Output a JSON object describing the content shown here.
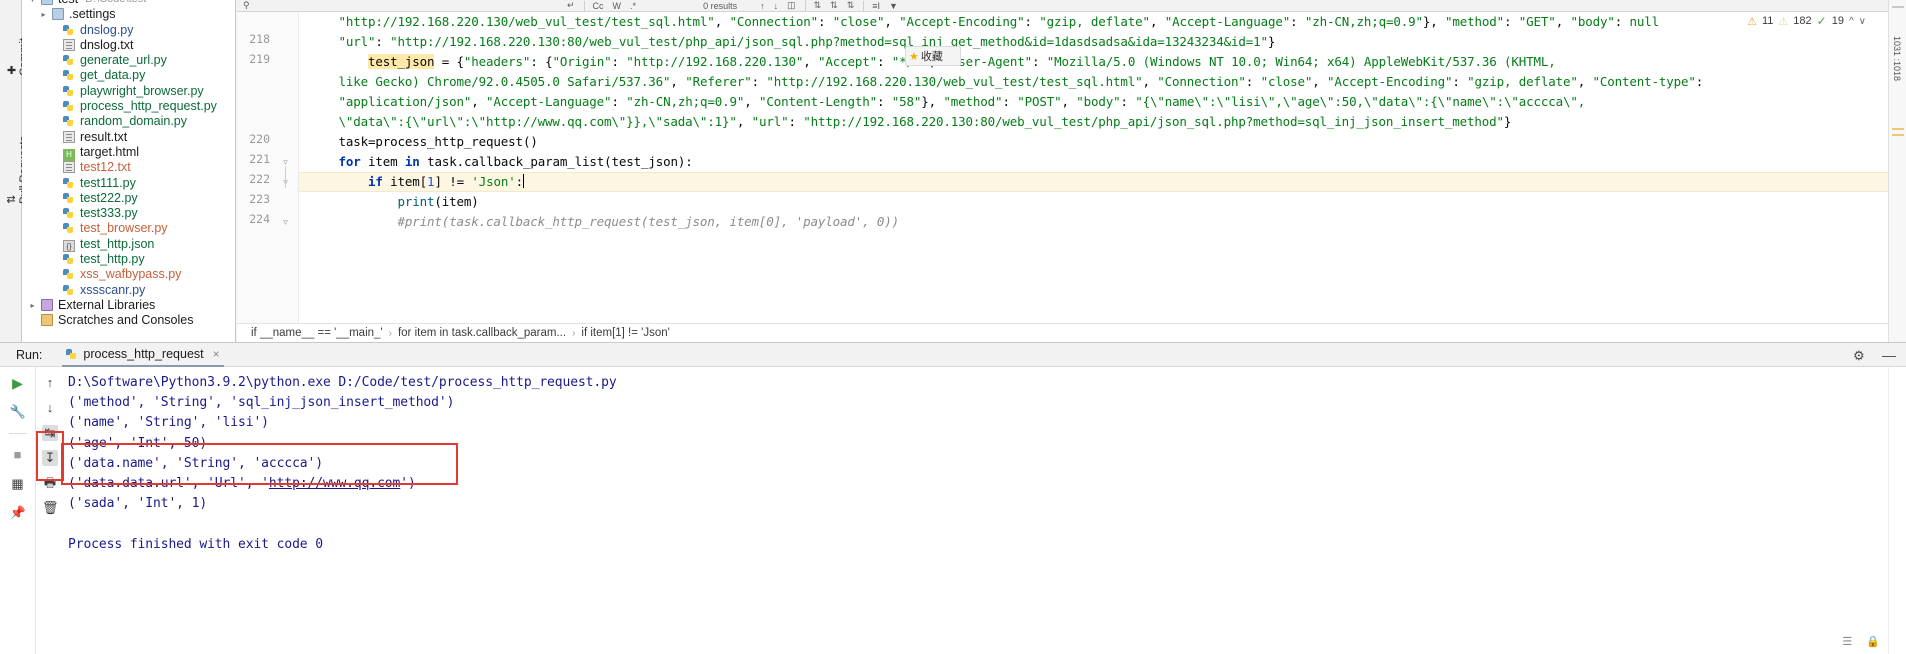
{
  "left_toolwindow": {
    "items": [
      {
        "label": "Commit",
        "icon": "commit-icon"
      },
      {
        "label": "Pull Requests",
        "icon": "pull-request-icon"
      }
    ]
  },
  "project_tree": {
    "items": [
      {
        "name": "test",
        "type": "folder",
        "detail": "D:\\Code\\test",
        "indent": 0,
        "arrow": "expanded",
        "color": "dark"
      },
      {
        "name": ".settings",
        "type": "folder",
        "indent": 1,
        "arrow": "collapsed",
        "color": "dark"
      },
      {
        "name": "dnslog.py",
        "type": "py",
        "indent": 2,
        "arrow": "",
        "color": "blue"
      },
      {
        "name": "dnslog.txt",
        "type": "txt",
        "indent": 2,
        "arrow": "",
        "color": "dark"
      },
      {
        "name": "generate_url.py",
        "type": "py",
        "indent": 2,
        "arrow": "",
        "color": "green"
      },
      {
        "name": "get_data.py",
        "type": "py",
        "indent": 2,
        "arrow": "",
        "color": "green"
      },
      {
        "name": "playwright_browser.py",
        "type": "py",
        "indent": 2,
        "arrow": "",
        "color": "green"
      },
      {
        "name": "process_http_request.py",
        "type": "py",
        "indent": 2,
        "arrow": "",
        "color": "green"
      },
      {
        "name": "random_domain.py",
        "type": "py",
        "indent": 2,
        "arrow": "",
        "color": "green"
      },
      {
        "name": "result.txt",
        "type": "txt",
        "indent": 2,
        "arrow": "",
        "color": "dark"
      },
      {
        "name": "target.html",
        "type": "html",
        "indent": 2,
        "arrow": "",
        "color": "dark"
      },
      {
        "name": "test12.txt",
        "type": "txt",
        "indent": 2,
        "arrow": "",
        "color": "red"
      },
      {
        "name": "test111.py",
        "type": "py",
        "indent": 2,
        "arrow": "",
        "color": "green"
      },
      {
        "name": "test222.py",
        "type": "py",
        "indent": 2,
        "arrow": "",
        "color": "green"
      },
      {
        "name": "test333.py",
        "type": "py",
        "indent": 2,
        "arrow": "",
        "color": "green"
      },
      {
        "name": "test_browser.py",
        "type": "py",
        "indent": 2,
        "arrow": "",
        "color": "red"
      },
      {
        "name": "test_http.json",
        "type": "json",
        "indent": 2,
        "arrow": "",
        "color": "green"
      },
      {
        "name": "test_http.py",
        "type": "py",
        "indent": 2,
        "arrow": "",
        "color": "green"
      },
      {
        "name": "xss_wafbypass.py",
        "type": "py",
        "indent": 2,
        "arrow": "",
        "color": "red"
      },
      {
        "name": "xssscanr.py",
        "type": "py",
        "indent": 2,
        "arrow": "",
        "color": "blue"
      },
      {
        "name": "External Libraries",
        "type": "lib",
        "indent": 0,
        "arrow": "collapsed",
        "color": "dark"
      },
      {
        "name": "Scratches and Consoles",
        "type": "scratch",
        "indent": 0,
        "arrow": "",
        "color": "dark"
      }
    ]
  },
  "find_bar": {
    "search_placeholder": "",
    "results_label": "0 results",
    "icons": [
      "search-icon",
      "enter-icon",
      "match-case-icon",
      "words-icon",
      "regex-icon",
      "up-icon",
      "down-icon",
      "select-all-icon",
      "in-comments-icon",
      "in-literals-icon",
      "in-identifiers-icon",
      "filter-icon",
      "close-icon"
    ]
  },
  "editor": {
    "lines": [
      {
        "number": "",
        "fold": "",
        "segments": [
          {
            "t": "    ",
            "c": "plain"
          },
          {
            "t": "\"http://192.168.220.130/web_vul_test/test_sql.html\"",
            "c": "str"
          },
          {
            "t": ", ",
            "c": "plain"
          },
          {
            "t": "\"Connection\"",
            "c": "str"
          },
          {
            "t": ": ",
            "c": "plain"
          },
          {
            "t": "\"close\"",
            "c": "str"
          },
          {
            "t": ", ",
            "c": "plain"
          },
          {
            "t": "\"Accept-Encoding\"",
            "c": "str"
          },
          {
            "t": ": ",
            "c": "plain"
          },
          {
            "t": "\"gzip, deflate\"",
            "c": "str"
          },
          {
            "t": ", ",
            "c": "plain"
          },
          {
            "t": "\"Accept-Language\"",
            "c": "str"
          },
          {
            "t": ": ",
            "c": "plain"
          },
          {
            "t": "\"zh-CN,zh;q=0.9\"",
            "c": "str"
          },
          {
            "t": "}, ",
            "c": "plain"
          },
          {
            "t": "\"method\"",
            "c": "str"
          },
          {
            "t": ": ",
            "c": "plain"
          },
          {
            "t": "\"GET\"",
            "c": "str"
          },
          {
            "t": ", ",
            "c": "plain"
          },
          {
            "t": "\"body\"",
            "c": "str"
          },
          {
            "t": ": ",
            "c": "plain"
          },
          {
            "t": "null",
            "c": "str"
          }
        ]
      },
      {
        "number": "218",
        "fold": "",
        "segments": [
          {
            "t": "    ",
            "c": "plain"
          },
          {
            "t": "\"url\"",
            "c": "str"
          },
          {
            "t": ": ",
            "c": "plain"
          },
          {
            "t": "\"http://192.168.220.130:80/web_vul_test/php_api/json_sql.php?method=sql_inj_get_method&id=1dasdsadsa&ida=13243234&id=1\"",
            "c": "str"
          },
          {
            "t": "}",
            "c": "plain"
          }
        ]
      },
      {
        "number": "219",
        "fold": "",
        "segments": [
          {
            "t": "        ",
            "c": "plain"
          },
          {
            "t": "test_json",
            "c": "hl"
          },
          {
            "t": " = {",
            "c": "plain"
          },
          {
            "t": "\"headers\"",
            "c": "str"
          },
          {
            "t": ": {",
            "c": "plain"
          },
          {
            "t": "\"Origin\"",
            "c": "str"
          },
          {
            "t": ": ",
            "c": "plain"
          },
          {
            "t": "\"http://192.168.220.130\"",
            "c": "str"
          },
          {
            "t": ", ",
            "c": "plain"
          },
          {
            "t": "\"Accept\"",
            "c": "str"
          },
          {
            "t": ": ",
            "c": "plain"
          },
          {
            "t": "\"*/*\"",
            "c": "str"
          },
          {
            "t": ", ",
            "c": "plain"
          },
          {
            "t": "\"User-Agent\"",
            "c": "str"
          },
          {
            "t": ": ",
            "c": "plain"
          },
          {
            "t": "\"Mozilla/5.0 (Windows NT 10.0; Win64; x64) AppleWebKit/537.36 (KHTML,",
            "c": "str"
          }
        ]
      },
      {
        "number": "",
        "fold": "",
        "segments": [
          {
            "t": "    ",
            "c": "plain"
          },
          {
            "t": "like Gecko) Chrome/92.0.4505.0 Safari/537.36\"",
            "c": "str"
          },
          {
            "t": ", ",
            "c": "plain"
          },
          {
            "t": "\"Referer\"",
            "c": "str"
          },
          {
            "t": ": ",
            "c": "plain"
          },
          {
            "t": "\"http://192.168.220.130/web_vul_test/test_sql.html\"",
            "c": "str"
          },
          {
            "t": ", ",
            "c": "plain"
          },
          {
            "t": "\"Connection\"",
            "c": "str"
          },
          {
            "t": ": ",
            "c": "plain"
          },
          {
            "t": "\"close\"",
            "c": "str"
          },
          {
            "t": ", ",
            "c": "plain"
          },
          {
            "t": "\"Accept-Encoding\"",
            "c": "str"
          },
          {
            "t": ": ",
            "c": "plain"
          },
          {
            "t": "\"gzip, deflate\"",
            "c": "str"
          },
          {
            "t": ", ",
            "c": "plain"
          },
          {
            "t": "\"Content-type\"",
            "c": "str"
          },
          {
            "t": ":",
            "c": "plain"
          }
        ]
      },
      {
        "number": "",
        "fold": "",
        "segments": [
          {
            "t": "    ",
            "c": "plain"
          },
          {
            "t": "\"application/json\"",
            "c": "str"
          },
          {
            "t": ", ",
            "c": "plain"
          },
          {
            "t": "\"Accept-Language\"",
            "c": "str"
          },
          {
            "t": ": ",
            "c": "plain"
          },
          {
            "t": "\"zh-CN,zh;q=0.9\"",
            "c": "str"
          },
          {
            "t": ", ",
            "c": "plain"
          },
          {
            "t": "\"Content-Length\"",
            "c": "str"
          },
          {
            "t": ": ",
            "c": "plain"
          },
          {
            "t": "\"58\"",
            "c": "str"
          },
          {
            "t": "}, ",
            "c": "plain"
          },
          {
            "t": "\"method\"",
            "c": "str"
          },
          {
            "t": ": ",
            "c": "plain"
          },
          {
            "t": "\"POST\"",
            "c": "str"
          },
          {
            "t": ", ",
            "c": "plain"
          },
          {
            "t": "\"body\"",
            "c": "str"
          },
          {
            "t": ": ",
            "c": "plain"
          },
          {
            "t": "\"{\\\"name\\\":\\\"lisi\\\",\\\"age\\\":50,\\\"data\\\":{\\\"name\\\":\\\"acccca\\\",",
            "c": "str"
          }
        ]
      },
      {
        "number": "",
        "fold": "",
        "segments": [
          {
            "t": "    ",
            "c": "plain"
          },
          {
            "t": "\\\"data\\\":{\\\"url\\\":\\\"http://www.qq.com\\\"}},\\\"sada\\\":1}\"",
            "c": "str"
          },
          {
            "t": ", ",
            "c": "plain"
          },
          {
            "t": "\"url\"",
            "c": "str"
          },
          {
            "t": ": ",
            "c": "plain"
          },
          {
            "t": "\"http://192.168.220.130:80/web_vul_test/php_api/json_sql.php?method=sql_inj_json_insert_method\"",
            "c": "str"
          },
          {
            "t": "}",
            "c": "plain"
          }
        ]
      },
      {
        "number": "220",
        "fold": "",
        "segments": [
          {
            "t": "    ",
            "c": "plain"
          },
          {
            "t": "task",
            "c": "plain"
          },
          {
            "t": "=",
            "c": "plain"
          },
          {
            "t": "process_http_request",
            "c": "plain"
          },
          {
            "t": "()",
            "c": "plain"
          }
        ]
      },
      {
        "number": "221",
        "fold": "collapse",
        "segments": [
          {
            "t": "    ",
            "c": "plain"
          },
          {
            "t": "for",
            "c": "kw"
          },
          {
            "t": " item ",
            "c": "plain"
          },
          {
            "t": "in",
            "c": "kw"
          },
          {
            "t": " task.callback_param_list(test_json):",
            "c": "plain"
          }
        ]
      },
      {
        "number": "222",
        "fold": "collapse",
        "highlight": true,
        "segments": [
          {
            "t": "        ",
            "c": "plain"
          },
          {
            "t": "if",
            "c": "kw"
          },
          {
            "t": " item[",
            "c": "plain"
          },
          {
            "t": "1",
            "c": "num"
          },
          {
            "t": "] != ",
            "c": "plain"
          },
          {
            "t": "'Json'",
            "c": "str"
          },
          {
            "t": ":",
            "c": "plain"
          },
          {
            "t": "CARET",
            "c": "caret"
          }
        ]
      },
      {
        "number": "223",
        "fold": "",
        "segments": [
          {
            "t": "            ",
            "c": "plain"
          },
          {
            "t": "print",
            "c": "fn"
          },
          {
            "t": "(item)",
            "c": "plain"
          }
        ]
      },
      {
        "number": "224",
        "fold": "collapse",
        "segments": [
          {
            "t": "            ",
            "c": "plain"
          },
          {
            "t": "#print(task.callback_http_request(test_json, item[0], 'payload', 0))",
            "c": "com"
          }
        ]
      }
    ],
    "inspections": {
      "warnings": "11",
      "weak_warnings": "182",
      "ok_count": "19",
      "up_icon": "chevron-up-icon",
      "down_icon": "chevron-down-icon"
    },
    "favorite_tooltip": {
      "label": "收藏",
      "icon": "star-icon"
    },
    "right_strip_label": "1031 :1018"
  },
  "breadcrumb": {
    "items": [
      "if __name__ == '__main_'",
      "for item in task.callback_param...",
      "if item[1] != 'Json'"
    ],
    "separator": "›"
  },
  "run_panel": {
    "label": "Run:",
    "tab": {
      "title": "process_http_request",
      "icon": "python-file-icon",
      "close": "×"
    },
    "header_actions": [
      {
        "name": "settings-icon",
        "glyph": "⚙"
      },
      {
        "name": "hide-icon",
        "glyph": "−"
      }
    ],
    "toolbar_left": [
      {
        "name": "rerun-button",
        "glyph": "▶"
      },
      {
        "name": "edit-configuration-button",
        "glyph": "🔧"
      },
      {
        "name": "stop-button",
        "glyph": "■"
      },
      {
        "name": "servers-button",
        "glyph": "⌸"
      },
      {
        "name": "pin-button",
        "glyph": "📌"
      }
    ],
    "toolbar_right": [
      {
        "name": "up-stack-trace-button",
        "glyph": "↑"
      },
      {
        "name": "down-stack-trace-button",
        "glyph": "↓"
      },
      {
        "name": "soft-wrap-button",
        "glyph": "↵"
      },
      {
        "name": "scroll-to-end-button",
        "glyph": "↧"
      },
      {
        "name": "print-button",
        "glyph": "🖨"
      },
      {
        "name": "clear-all-button",
        "glyph": "🗑"
      }
    ],
    "console": {
      "lines": [
        {
          "text": "D:\\Software\\Python3.9.2\\python.exe D:/Code/test/process_http_request.py",
          "link": ""
        },
        {
          "text": "('method', 'String', 'sql_inj_json_insert_method')",
          "link": ""
        },
        {
          "text": "('name', 'String', 'lisi')",
          "link": ""
        },
        {
          "text": "('age', 'Int', 50)",
          "link": ""
        },
        {
          "text": "('data.name', 'String', 'acccca')",
          "link": ""
        },
        {
          "text": "('data.data.url', 'Url', '",
          "link": "http://www.qq.com",
          "suffix": "')"
        },
        {
          "text": "('sada', 'Int', 1)",
          "link": ""
        },
        {
          "text": "",
          "link": ""
        },
        {
          "text": "Process finished with exit code 0",
          "link": ""
        }
      ]
    },
    "highlight_color": "#e03b30"
  }
}
